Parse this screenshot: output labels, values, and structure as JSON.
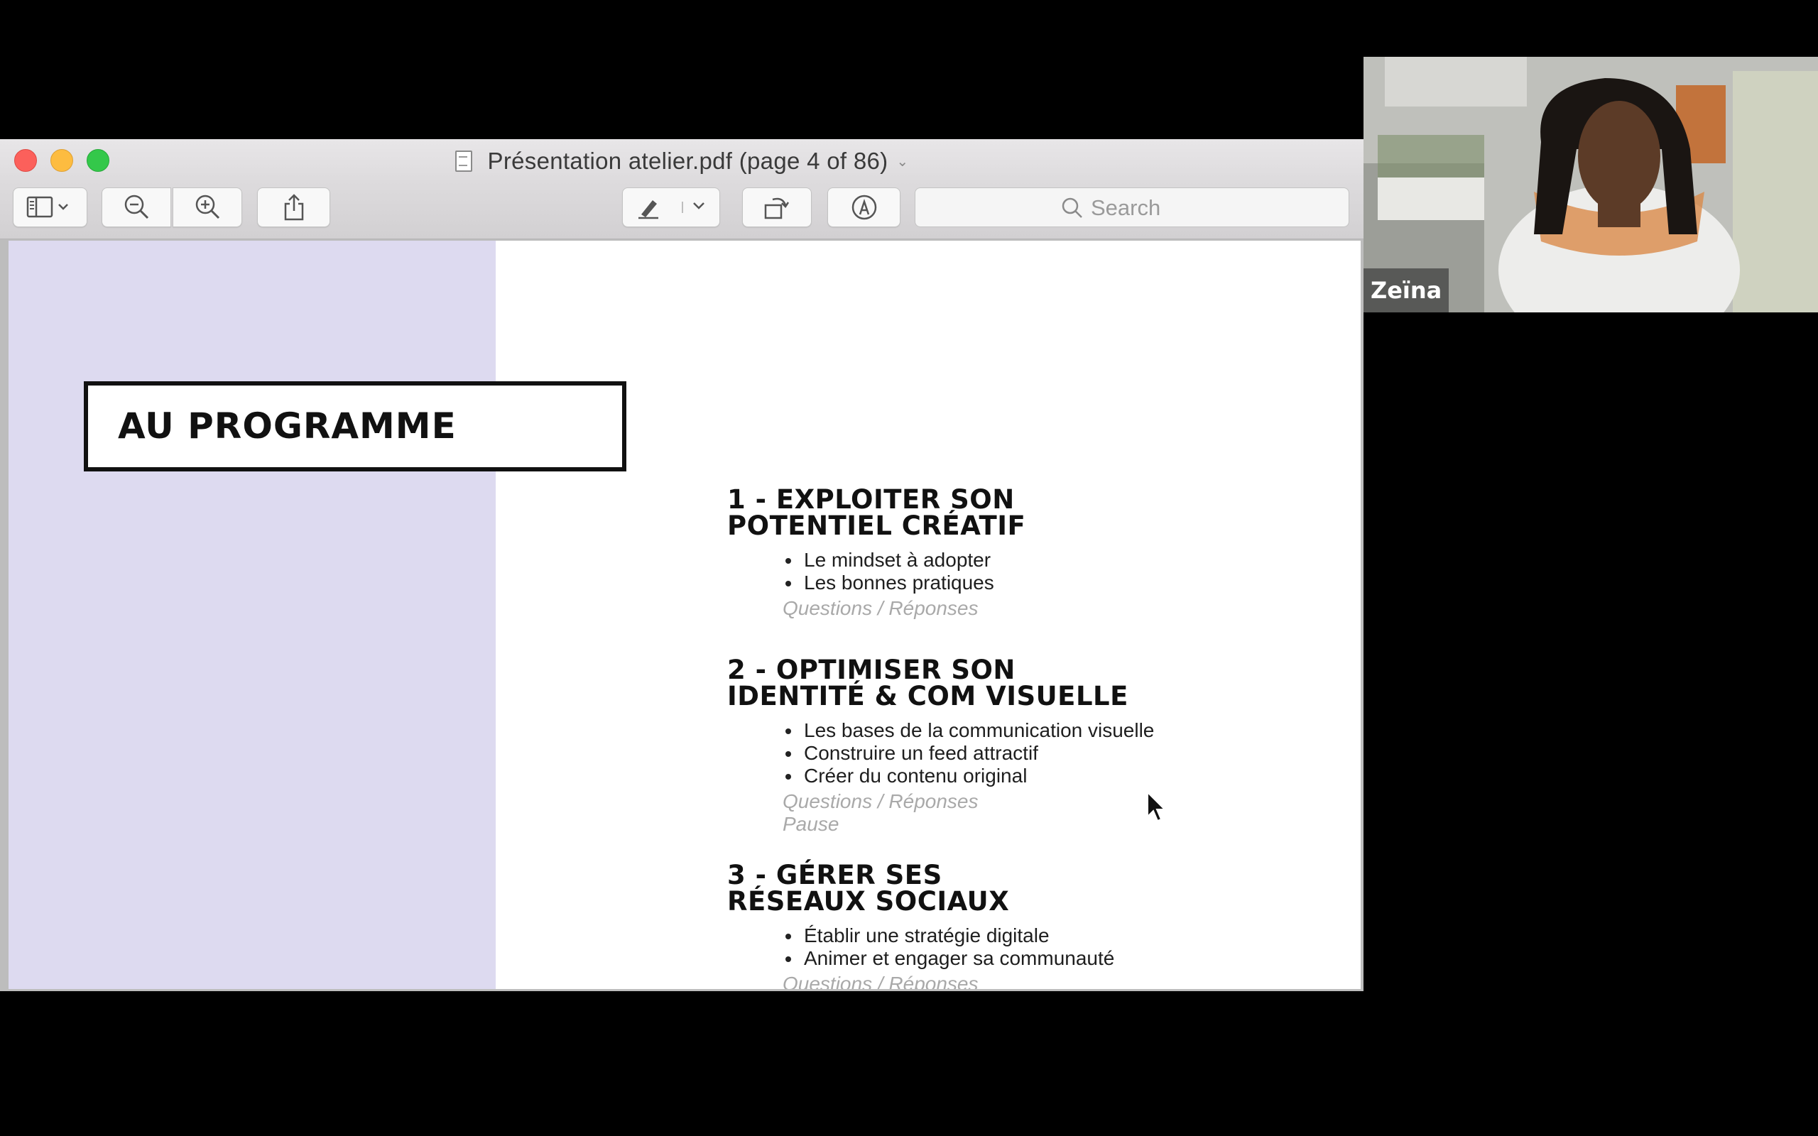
{
  "window": {
    "title": "Présentation atelier.pdf (page 4 of 86)"
  },
  "toolbar": {
    "icons": {
      "sidebar": "sidebar-view-icon",
      "zoom_out": "zoom-out-icon",
      "zoom_in": "zoom-in-icon",
      "share": "share-icon",
      "markup": "markup-pen-icon",
      "rotate": "rotate-icon",
      "annotate": "annotate-icon"
    },
    "search_placeholder": "Search"
  },
  "slide": {
    "heading": "AU PROGRAMME",
    "sections": [
      {
        "title_lines": [
          "1 - EXPLOITER SON",
          "POTENTIEL CRÉATIF"
        ],
        "bullets": [
          "Le mindset à adopter",
          "Les bonnes pratiques"
        ],
        "notes": [
          "Questions / Réponses"
        ]
      },
      {
        "title_lines": [
          "2 - OPTIMISER SON",
          "IDENTITÉ & COM VISUELLE"
        ],
        "bullets": [
          "Les bases de la communication visuelle",
          "Construire un feed attractif",
          "Créer du contenu original"
        ],
        "notes": [
          "Questions / Réponses",
          "Pause"
        ]
      },
      {
        "title_lines": [
          "3 - GÉRER SES",
          "RÉSEAUX SOCIAUX"
        ],
        "bullets": [
          "Établir une stratégie digitale",
          "Animer et engager sa communauté"
        ],
        "notes": [
          "Questions / Réponses"
        ]
      }
    ]
  },
  "video": {
    "participant_name": "Zeïna"
  },
  "colors": {
    "left_panel": "#dddaf0",
    "close": "#fc605b",
    "minimize": "#fdbc40",
    "maximize": "#34c84a"
  }
}
